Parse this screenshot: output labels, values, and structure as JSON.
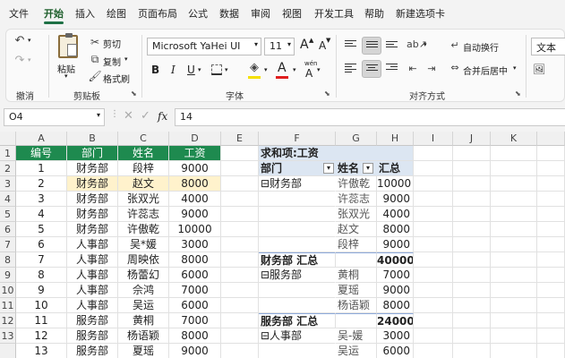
{
  "menu": {
    "tabs": [
      "文件",
      "开始",
      "插入",
      "绘图",
      "页面布局",
      "公式",
      "数据",
      "审阅",
      "视图",
      "开发工具",
      "帮助",
      "新建选项卡"
    ],
    "active": "开始"
  },
  "ribbon": {
    "undo_group": "撤消",
    "clipboard": {
      "paste": "粘贴",
      "cut": "剪切",
      "copy": "复制",
      "format_painter": "格式刷",
      "group": "剪贴板"
    },
    "font": {
      "name": "Microsoft YaHei UI",
      "size": "11",
      "bold": "B",
      "italic": "I",
      "underline": "U",
      "font_color_glyph": "A",
      "inc": "A",
      "dec": "A",
      "phonetic": "wén",
      "group": "字体"
    },
    "alignment": {
      "wrap": "自动换行",
      "merge": "合并后居中",
      "group": "对齐方式"
    },
    "number": {
      "format": "文本"
    }
  },
  "formula_bar": {
    "name_box": "O4",
    "fx": "fx",
    "value": "14"
  },
  "columns": [
    "A",
    "B",
    "C",
    "D",
    "E",
    "F",
    "G",
    "H",
    "I",
    "J",
    "K"
  ],
  "rows": [
    "1",
    "2",
    "3",
    "4",
    "5",
    "6",
    "7",
    "8",
    "9",
    "10",
    "11",
    "12",
    "13"
  ],
  "table": {
    "headers": [
      "编号",
      "部门",
      "姓名",
      "工资"
    ],
    "rows": [
      [
        "1",
        "财务部",
        "段梓",
        "9000"
      ],
      [
        "2",
        "财务部",
        "赵文",
        "8000"
      ],
      [
        "3",
        "财务部",
        "张双光",
        "4000"
      ],
      [
        "4",
        "财务部",
        "许蕊志",
        "9000"
      ],
      [
        "5",
        "财务部",
        "许傲乾",
        "10000"
      ],
      [
        "6",
        "人事部",
        "吴*媛",
        "3000"
      ],
      [
        "7",
        "人事部",
        "周映依",
        "8000"
      ],
      [
        "8",
        "人事部",
        "杨蕾幻",
        "6000"
      ],
      [
        "9",
        "人事部",
        "佘鸿",
        "7000"
      ],
      [
        "10",
        "人事部",
        "吴运",
        "6000"
      ],
      [
        "11",
        "服务部",
        "黄桐",
        "7000"
      ],
      [
        "12",
        "服务部",
        "杨语颖",
        "8000"
      ],
      [
        "13",
        "服务部",
        "夏瑶",
        "9000"
      ]
    ]
  },
  "pivot": {
    "title": "求和项:工资",
    "dept_header": "部门",
    "name_header": "姓名",
    "total_header": "汇总",
    "rows": [
      {
        "dept": "⊟财务部",
        "name": "许傲乾",
        "value": "10000"
      },
      {
        "dept": "",
        "name": "许蕊志",
        "value": "9000"
      },
      {
        "dept": "",
        "name": "张双光",
        "value": "4000"
      },
      {
        "dept": "",
        "name": "赵文",
        "value": "8000"
      },
      {
        "dept": "",
        "name": "段梓",
        "value": "9000"
      },
      {
        "dept": "财务部 汇总",
        "name": "",
        "value": "40000",
        "subtotal": true
      },
      {
        "dept": "⊟服务部",
        "name": "黄桐",
        "value": "7000"
      },
      {
        "dept": "",
        "name": "夏瑶",
        "value": "9000"
      },
      {
        "dept": "",
        "name": "杨语颖",
        "value": "8000"
      },
      {
        "dept": "服务部 汇总",
        "name": "",
        "value": "24000",
        "subtotal": true
      },
      {
        "dept": "⊟人事部",
        "name": "吴-媛",
        "value": "3000"
      },
      {
        "dept": "",
        "name": "吴运",
        "value": "6000"
      }
    ]
  }
}
